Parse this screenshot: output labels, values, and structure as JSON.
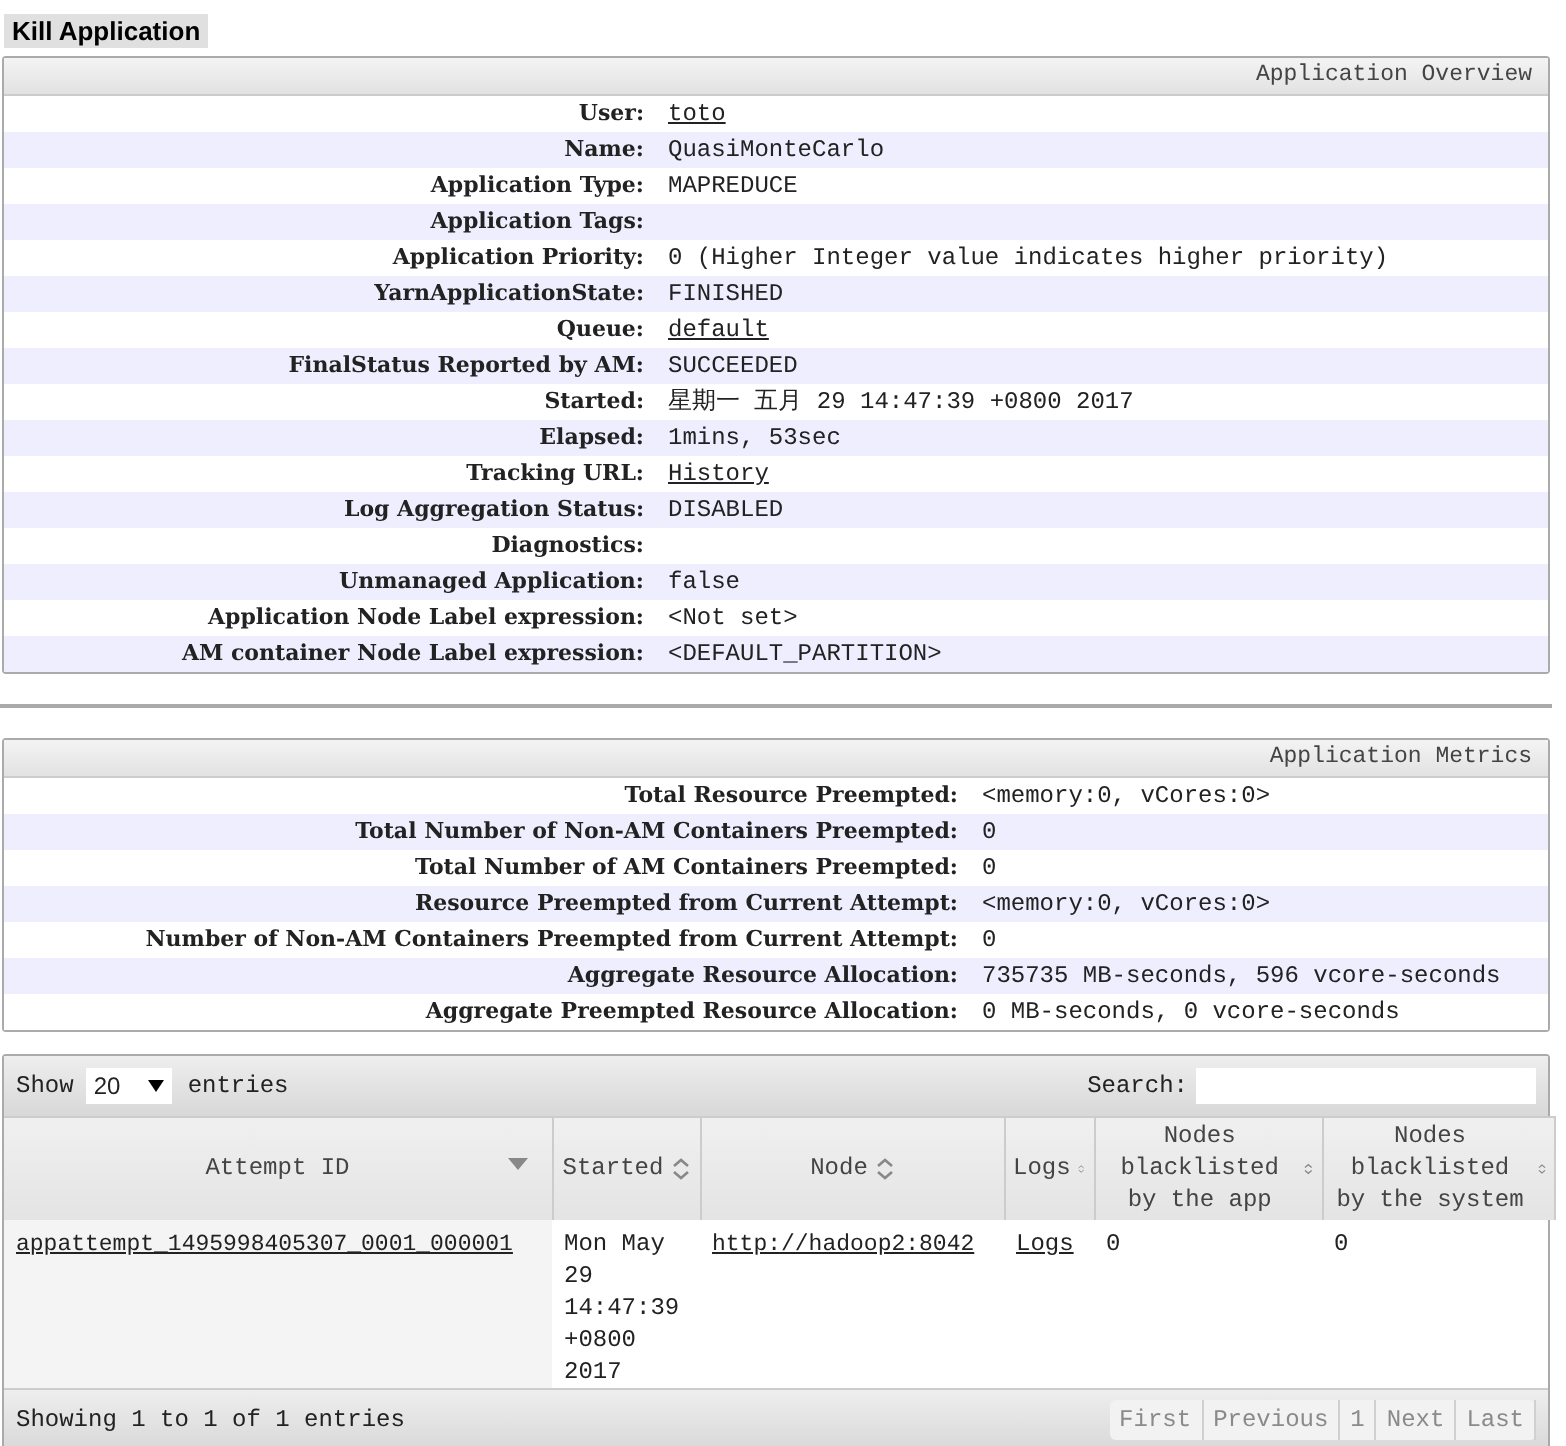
{
  "kill_button": "Kill Application",
  "overview": {
    "title": "Application Overview",
    "rows": [
      {
        "label": "User:",
        "value": "toto",
        "kind": "link"
      },
      {
        "label": "Name:",
        "value": "QuasiMonteCarlo",
        "kind": "text"
      },
      {
        "label": "Application Type:",
        "value": "MAPREDUCE",
        "kind": "text"
      },
      {
        "label": "Application Tags:"
      },
      {
        "label": "Application Priority:",
        "value": "0 (Higher Integer value indicates higher priority)",
        "kind": "text"
      },
      {
        "label": "YarnApplicationState:",
        "value": "FINISHED",
        "kind": "text"
      },
      {
        "label": "Queue:",
        "value": "default",
        "kind": "link"
      },
      {
        "label": "FinalStatus Reported by AM:",
        "value": "SUCCEEDED",
        "kind": "text"
      },
      {
        "label": "Started:",
        "value": "星期一 五月 29 14:47:39 +0800 2017",
        "kind": "text"
      },
      {
        "label": "Elapsed:",
        "value": "1mins, 53sec",
        "kind": "text"
      },
      {
        "label": "Tracking URL:",
        "value": "History",
        "kind": "link"
      },
      {
        "label": "Log Aggregation Status:",
        "value": "DISABLED",
        "kind": "text"
      },
      {
        "label": "Diagnostics:"
      },
      {
        "label": "Unmanaged Application:",
        "value": "false",
        "kind": "text"
      },
      {
        "label": "Application Node Label expression:",
        "value": "<Not set>",
        "kind": "text"
      },
      {
        "label": "AM container Node Label expression:",
        "value": "<DEFAULT_PARTITION>",
        "kind": "text"
      }
    ]
  },
  "metrics": {
    "title": "Application Metrics",
    "rows": [
      {
        "label": "Total Resource Preempted:",
        "value": "<memory:0, vCores:0>",
        "kind": "text"
      },
      {
        "label": "Total Number of Non-AM Containers Preempted:",
        "value": "0",
        "kind": "text"
      },
      {
        "label": "Total Number of AM Containers Preempted:",
        "value": "0",
        "kind": "text"
      },
      {
        "label": "Resource Preempted from Current Attempt:",
        "value": "<memory:0, vCores:0>",
        "kind": "text"
      },
      {
        "label": "Number of Non-AM Containers Preempted from Current Attempt:",
        "value": "0",
        "kind": "text"
      },
      {
        "label": "Aggregate Resource Allocation:",
        "value": "735735 MB-seconds, 596 vcore-seconds",
        "kind": "text"
      },
      {
        "label": "Aggregate Preempted Resource Allocation:",
        "value": "0 MB-seconds, 0 vcore-seconds",
        "kind": "text"
      }
    ]
  },
  "attempts": {
    "show_label": "Show",
    "page_size": "20",
    "entries_label": "entries",
    "search_label": "Search:",
    "columns": [
      {
        "label": "Attempt ID",
        "sorted": true
      },
      {
        "label": "Started",
        "sorted": false
      },
      {
        "label": "Node",
        "sorted": false
      },
      {
        "label": "Logs",
        "sorted": false
      },
      {
        "label": "Nodes blacklisted by the app",
        "sorted": false
      },
      {
        "label": "Nodes blacklisted by the system",
        "sorted": false
      }
    ],
    "rows": [
      {
        "attempt_id": "appattempt_1495998405307_0001_000001",
        "started": "Mon May 29 14:47:39 +0800 2017",
        "node": "http://hadoop2:8042",
        "logs": "Logs",
        "blacklisted_app": "0",
        "blacklisted_system": "0"
      }
    ],
    "info": "Showing 1 to 1 of 1 entries",
    "pagination": [
      {
        "label": "First",
        "disabled": true
      },
      {
        "label": "Previous",
        "disabled": true
      },
      {
        "label": "1",
        "disabled": true
      },
      {
        "label": "Next",
        "disabled": true
      },
      {
        "label": "Last",
        "disabled": true
      }
    ]
  }
}
